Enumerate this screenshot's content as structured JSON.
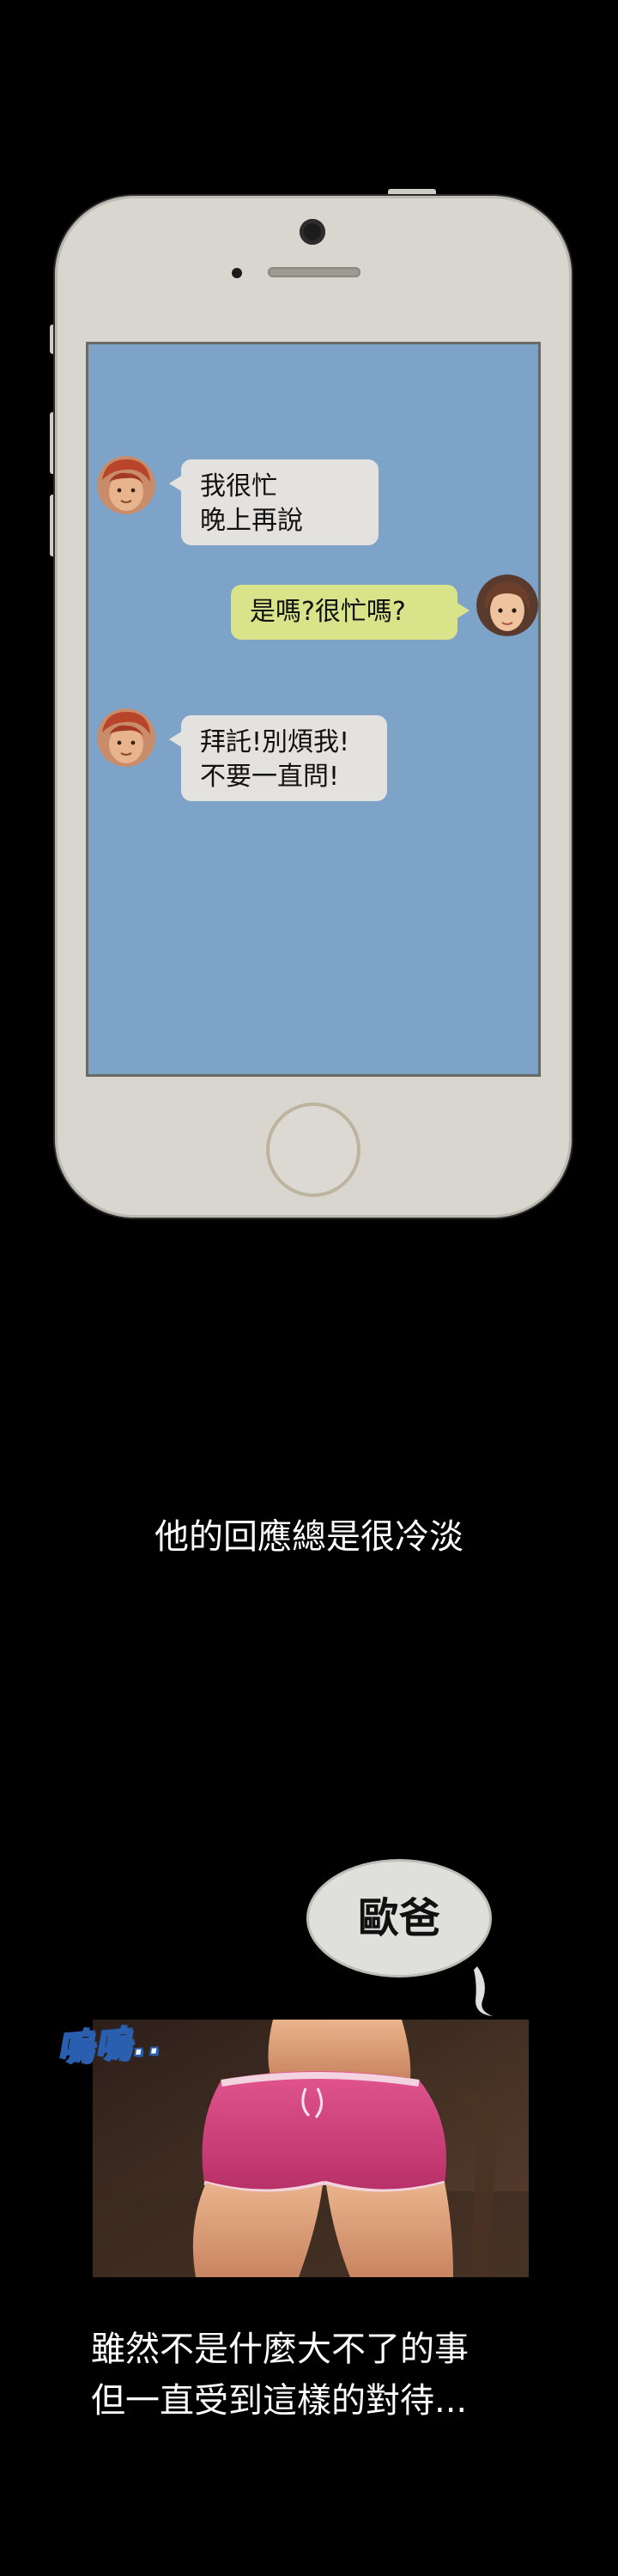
{
  "chat": {
    "messages": [
      {
        "side": "in",
        "lines": "我很忙\n晚上再說"
      },
      {
        "side": "out",
        "lines": "是嗎?很忙嗎?"
      },
      {
        "side": "in",
        "lines": "拜託!別煩我!\n不要一直問!"
      }
    ]
  },
  "narration": {
    "line1": "他的回應總是很冷淡",
    "line2": "雖然不是什麼大不了的事",
    "line3": "但一直受到這樣的對待..."
  },
  "panel": {
    "thought": "歐爸",
    "sfx": "嗚嗚.."
  },
  "colors": {
    "background": "#000000",
    "phone_body": "#d8d6cf",
    "screen": "#7ea3c8",
    "bubble_in": "#e4e2df",
    "bubble_out": "#d9e38a"
  }
}
